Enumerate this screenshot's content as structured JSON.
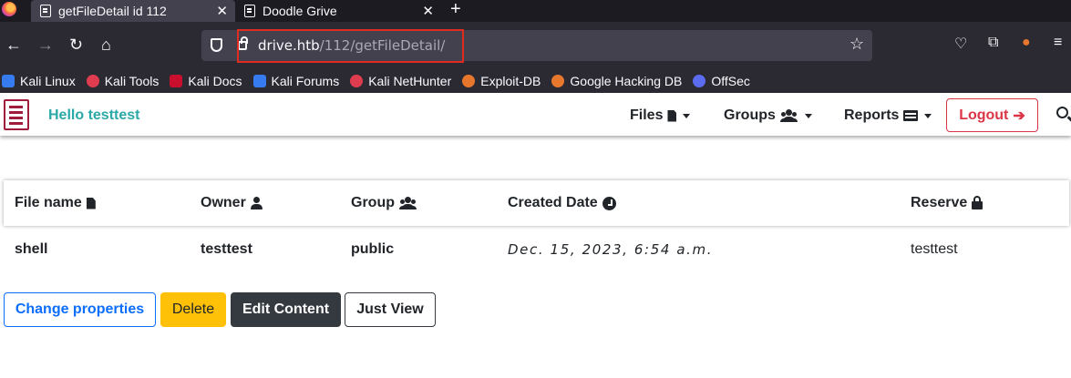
{
  "browser": {
    "tabs": [
      {
        "title": "getFileDetail id 112",
        "active": true
      },
      {
        "title": "Doodle Grive",
        "active": false
      }
    ],
    "url": {
      "domain": "drive.htb",
      "path": "/112/getFileDetail/"
    },
    "bookmarks": [
      {
        "label": "Kali Linux",
        "color": "#367bf0"
      },
      {
        "label": "Kali Tools",
        "color": "#e03c4f"
      },
      {
        "label": "Kali Docs",
        "color": "#c8102e"
      },
      {
        "label": "Kali Forums",
        "color": "#367bf0"
      },
      {
        "label": "Kali NetHunter",
        "color": "#e03c4f"
      },
      {
        "label": "Exploit-DB",
        "color": "#e8772e"
      },
      {
        "label": "Google Hacking DB",
        "color": "#e8772e"
      },
      {
        "label": "OffSec",
        "color": "#5b6cf0"
      }
    ]
  },
  "header": {
    "greeting": "Hello testtest",
    "menu": {
      "files": "Files",
      "groups": "Groups",
      "reports": "Reports"
    },
    "logout": "Logout"
  },
  "table": {
    "columns": {
      "file_name": "File name",
      "owner": "Owner",
      "group": "Group",
      "created": "Created Date",
      "reserve": "Reserve"
    },
    "rows": [
      {
        "file_name": "shell",
        "owner": "testtest",
        "group": "public",
        "created": "Dec. 15, 2023, 6:54 a.m.",
        "reserve": "testtest"
      }
    ]
  },
  "actions": {
    "change": "Change properties",
    "delete": "Delete",
    "edit": "Edit Content",
    "view": "Just View"
  }
}
